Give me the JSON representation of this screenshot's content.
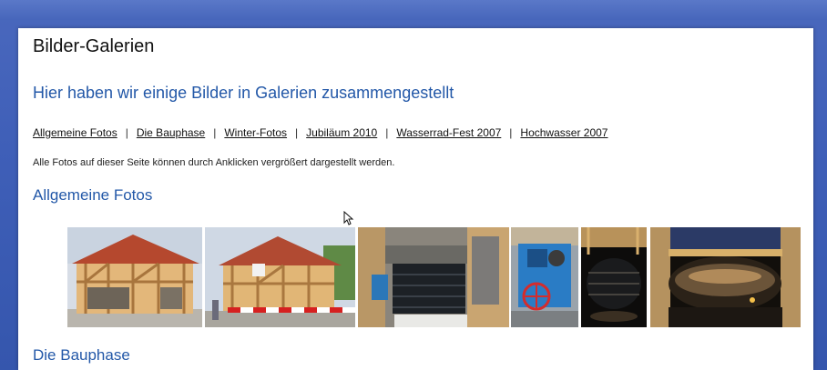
{
  "page": {
    "title": "Bilder-Galerien",
    "subtitle": "Hier haben wir einige Bilder in Galerien zusammengestellt",
    "note": "Alle Fotos auf dieser Seite können durch Anklicken vergrößert dargestellt werden."
  },
  "nav": {
    "links": [
      "Allgemeine Fotos",
      "Die Bauphase",
      "Winter-Fotos",
      "Jubiläum 2010",
      "Wasserrad-Fest 2007",
      "Hochwasser 2007"
    ],
    "separator": "|"
  },
  "sections": {
    "first": "Allgemeine Fotos",
    "second": "Die Bauphase"
  },
  "photos": [
    {
      "subject": "timber-frame-building"
    },
    {
      "subject": "timber-frame-building-with-barrier"
    },
    {
      "subject": "water-wheel-pit"
    },
    {
      "subject": "blue-gear-machinery"
    },
    {
      "subject": "water-wheel-dark"
    },
    {
      "subject": "water-wheel-night"
    }
  ]
}
